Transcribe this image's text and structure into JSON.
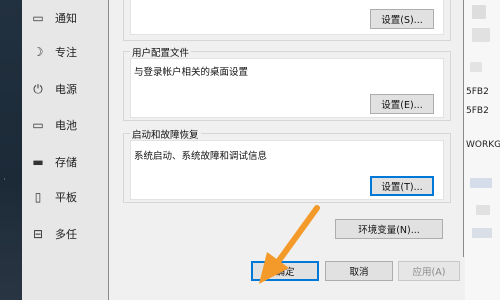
{
  "settings_sidebar": {
    "items": [
      {
        "label": "通知",
        "icon": "message-icon"
      },
      {
        "label": "专注",
        "icon": "moon-icon"
      },
      {
        "label": "电源",
        "icon": "power-icon"
      },
      {
        "label": "电池",
        "icon": "battery-icon"
      },
      {
        "label": "存储",
        "icon": "storage-icon"
      },
      {
        "label": "平板",
        "icon": "tablet-icon"
      },
      {
        "label": "多任",
        "icon": "multitask-icon"
      }
    ]
  },
  "system_info": {
    "values": [
      "5FB2",
      "5FB2",
      "WORKG"
    ]
  },
  "dialog": {
    "performance_settings_button": "设置(S)...",
    "user_profiles": {
      "title": "用户配置文件",
      "description": "与登录帐户相关的桌面设置",
      "button": "设置(E)..."
    },
    "startup_recovery": {
      "title": "启动和故障恢复",
      "description": "系统启动、系统故障和调试信息",
      "button": "设置(T)..."
    },
    "env_vars_button": "环境变量(N)...",
    "ok_button": "确定",
    "cancel_button": "取消",
    "apply_button": "应用(A)"
  },
  "colors": {
    "arrow": "#f39a2b",
    "focus": "#0078d7"
  }
}
